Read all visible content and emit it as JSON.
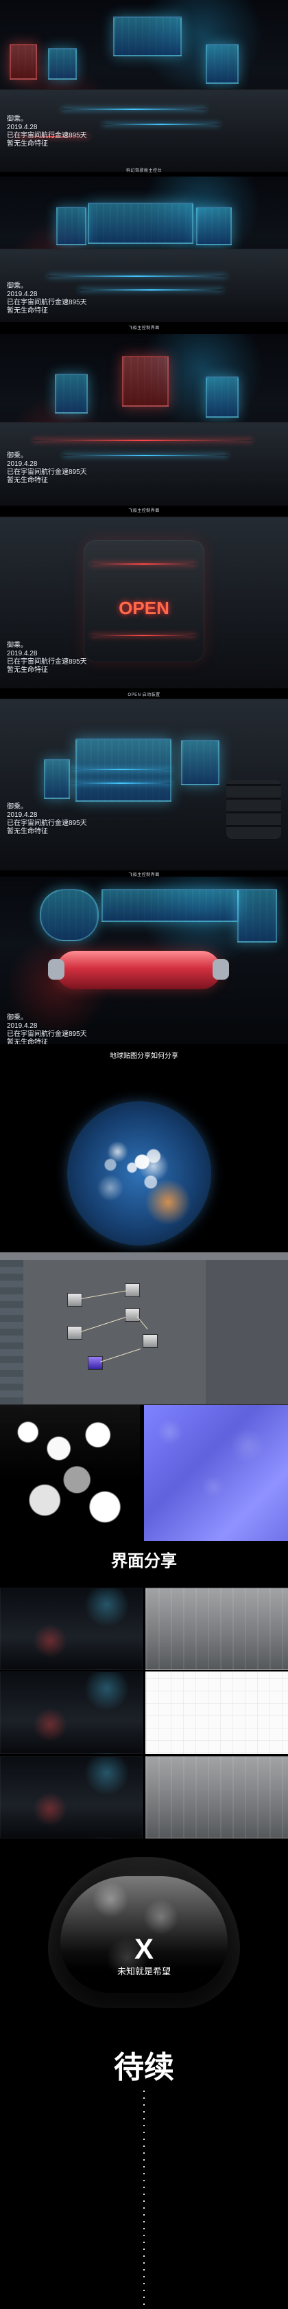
{
  "overlays": {
    "block_1": {
      "line1": "御乘。",
      "line2": "2019.4.28",
      "line3": "已在宇宙间航行金速895天",
      "line4": "暂无生命特征"
    },
    "block_2": {
      "line1": "御乘。",
      "line2": "2019.4.28",
      "line3": "已在宇宙间航行金速895天",
      "line4": "暂无生命特征"
    },
    "block_3": {
      "line1": "御乘。",
      "line2": "2019.4.28",
      "line3": "已在宇宙间航行金速895天",
      "line4": "暂无生命特征"
    },
    "block_4": {
      "line1": "御乘。",
      "line2": "2019.4.28",
      "line3": "已在宇宙间航行金速895天",
      "line4": "暂无生命特征"
    },
    "block_5": {
      "line1": "御乘。",
      "line2": "2019.4.28",
      "line3": "已在宇宙间航行金速895天",
      "line4": "暂无生命特征"
    },
    "block_6": {
      "line1": "御乘。",
      "line2": "2019.4.28",
      "line3": "已在宇宙间航行金速895天",
      "line4": "暂无生命特征"
    }
  },
  "captions": {
    "c1": "科幻驾驶舱主控台",
    "c2": "飞船主控制界面",
    "c3": "飞船主控制界面",
    "c4": "OPEN 启动装置",
    "c5": "飞船主控制界面"
  },
  "sections": {
    "earth_caption": "地球贴图分享如何分享",
    "interface_title": "界面分享",
    "helmet_symbol": "X",
    "helmet_subtitle": "未知就是希望",
    "to_be_continued": "待续"
  },
  "decor": {
    "open_label": "OPEN",
    "panel_red": "#ff4848",
    "panel_blue": "#45c7ff"
  }
}
